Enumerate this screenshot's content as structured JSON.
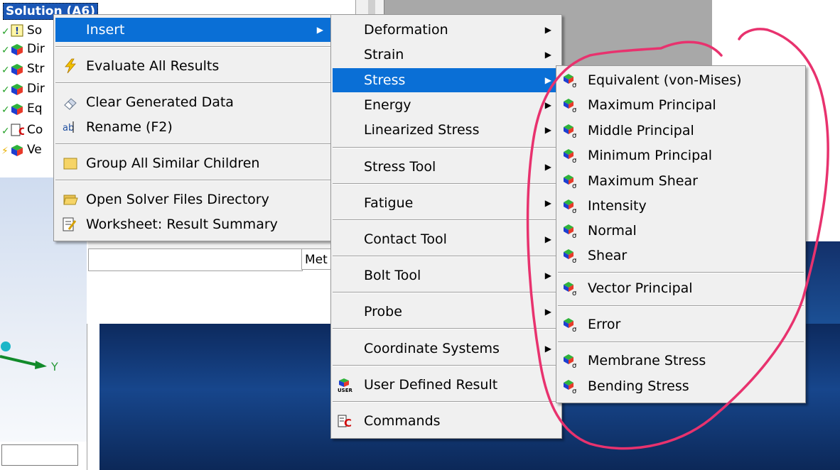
{
  "tree": {
    "header": "Solution (A6)",
    "rows": [
      {
        "label": "So"
      },
      {
        "label": "Dir"
      },
      {
        "label": "Str"
      },
      {
        "label": "Dir"
      },
      {
        "label": "Eq"
      },
      {
        "label": "Co"
      },
      {
        "label": "Ve"
      }
    ]
  },
  "details": {
    "field_text": "Met"
  },
  "axis": {
    "label": "Y"
  },
  "context_menu": {
    "items": [
      {
        "label": "Insert",
        "icon": "none",
        "submenu": true,
        "highlighted": true
      },
      {
        "label": "Evaluate All Results",
        "icon": "lightning-icon"
      },
      {
        "label": "Clear Generated Data",
        "icon": "eraser-icon"
      },
      {
        "label": "Rename (F2)",
        "icon": "rename-icon"
      },
      {
        "label": "Group All Similar Children",
        "icon": "folder-icon"
      },
      {
        "label": "Open Solver Files Directory",
        "icon": "open-folder-icon"
      },
      {
        "label": "Worksheet: Result Summary",
        "icon": "worksheet-icon"
      }
    ]
  },
  "insert_menu": {
    "items": [
      {
        "label": "Deformation",
        "submenu": true
      },
      {
        "label": "Strain",
        "submenu": true
      },
      {
        "label": "Stress",
        "submenu": true,
        "highlighted": true
      },
      {
        "label": "Energy",
        "submenu": true
      },
      {
        "label": "Linearized Stress",
        "submenu": true
      },
      {
        "label": "Stress Tool",
        "submenu": true
      },
      {
        "label": "Fatigue",
        "submenu": true
      },
      {
        "label": "Contact Tool",
        "submenu": true
      },
      {
        "label": "Bolt Tool",
        "submenu": true
      },
      {
        "label": "Probe",
        "submenu": true
      },
      {
        "label": "Coordinate Systems",
        "submenu": true
      },
      {
        "label": "User Defined Result",
        "icon": "user-result-icon"
      },
      {
        "label": "Commands",
        "icon": "commands-icon"
      }
    ]
  },
  "stress_menu": {
    "items": [
      {
        "label": "Equivalent (von-Mises)"
      },
      {
        "label": "Maximum Principal"
      },
      {
        "label": "Middle Principal"
      },
      {
        "label": "Minimum Principal"
      },
      {
        "label": "Maximum Shear"
      },
      {
        "label": "Intensity"
      },
      {
        "label": "Normal"
      },
      {
        "label": "Shear"
      },
      {
        "label": "Vector Principal"
      },
      {
        "label": "Error"
      },
      {
        "label": "Membrane Stress"
      },
      {
        "label": "Bending Stress"
      }
    ]
  },
  "colors": {
    "highlight": "#0a6fd6",
    "annotation": "#e8326e",
    "menu_bg": "#f0f0f0"
  },
  "icons": {
    "stress_item": "stress-result-icon",
    "arrow": "submenu-arrow-icon"
  }
}
